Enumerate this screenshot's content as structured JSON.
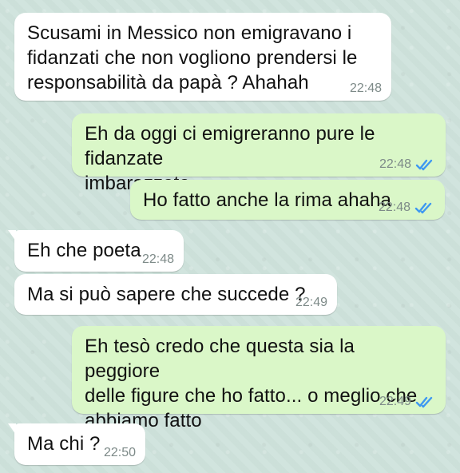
{
  "conversation": {
    "messages": [
      {
        "direction": "incoming",
        "text": "Scusami in Messico non emigravano i\nfidanzati che non vogliono prendersi le\nresponsabilità da papà ? Ahahah",
        "time": "22:48"
      },
      {
        "direction": "outgoing",
        "text": "Eh da oggi ci emigreranno pure le fidanzate\nimbarazzate",
        "time": "22:48",
        "status": "read-double-check-icon"
      },
      {
        "direction": "outgoing",
        "text": "Ho fatto anche la rima ahaha",
        "time": "22:48",
        "status": "read-double-check-icon"
      },
      {
        "direction": "incoming",
        "text": "Eh che poeta",
        "time": "22:48"
      },
      {
        "direction": "incoming",
        "text": "Ma si può sapere che succede ?",
        "time": "22:49"
      },
      {
        "direction": "outgoing",
        "text": "Eh tesò credo che questa sia la peggiore\ndelle figure che ho fatto... o meglio che\nabbiamo fatto",
        "time": "22:49",
        "status": "read-double-check-icon"
      },
      {
        "direction": "incoming",
        "text": "Ma chi ?",
        "time": "22:50"
      }
    ]
  },
  "colors": {
    "chat_background": "#cfe3dc",
    "incoming_bubble": "#ffffff",
    "outgoing_bubble": "#daf7c8",
    "timestamp": "#7d8a88",
    "read_ticks": "#3e98f1"
  }
}
